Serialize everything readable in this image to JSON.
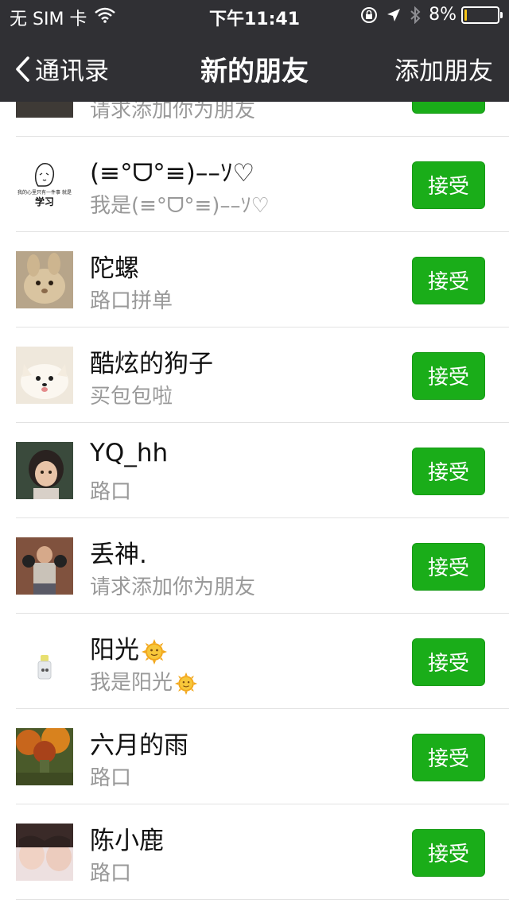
{
  "status_bar": {
    "carrier": "无 SIM 卡",
    "time": "下午11:41",
    "battery_percent_text": "8%",
    "battery_level": 0.08,
    "icons": [
      "wifi-icon",
      "orientation-lock-icon",
      "location-arrow-icon",
      "bluetooth-icon",
      "battery-icon"
    ]
  },
  "nav": {
    "back_label": "通讯录",
    "title": "新的朋友",
    "right_label": "添加朋友"
  },
  "accept_label": "接受",
  "colors": {
    "nav_background": "#303034",
    "accept_button": "#1aad19",
    "secondary_text": "#999999",
    "battery_low": "#f5c518"
  },
  "requests": [
    {
      "name": "",
      "message": "请求添加你为朋友",
      "avatar": "dark-avatar-partial"
    },
    {
      "name": "(≡°ᗜ°≡)––ｿ♡",
      "message": "我是(≡°ᗜ°≡)––ｿ♡",
      "avatar": "sketch-learning-avatar",
      "avatar_caption_small": "我的心里只有一件事 就是",
      "avatar_caption_big": "学习"
    },
    {
      "name": "陀螺",
      "message": "路口拼单",
      "avatar": "rabbit-avatar"
    },
    {
      "name": "酷炫的狗子",
      "message": "买包包啦",
      "avatar": "white-dog-avatar"
    },
    {
      "name": "YQ_hh",
      "message": "路口",
      "avatar": "child-photo-avatar"
    },
    {
      "name": "丢神.",
      "message": "请求添加你为朋友",
      "avatar": "boxer-photo-avatar"
    },
    {
      "name": "阳光",
      "message": "我是阳光",
      "avatar": "bottle-avatar",
      "emoji": "sun-emoji"
    },
    {
      "name": "六月的雨",
      "message": "路口",
      "avatar": "autumn-forest-avatar"
    },
    {
      "name": "陈小鹿",
      "message": "路口",
      "avatar": "girl-photo-avatar"
    }
  ]
}
